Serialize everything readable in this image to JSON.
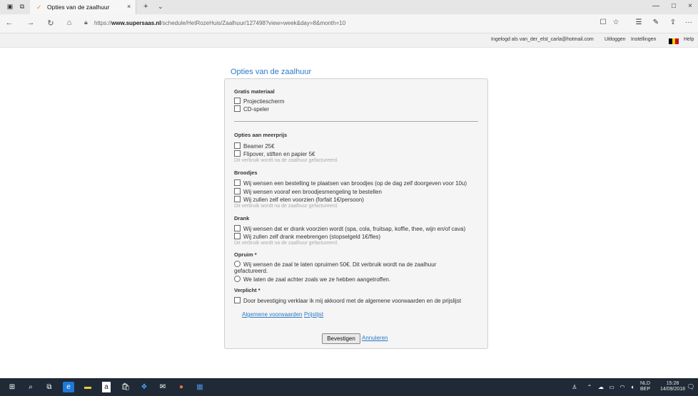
{
  "browser": {
    "tab_title": "Opties van de zaalhuur",
    "url_prefix": "https://",
    "url_domain": "www.supersaas.nl",
    "url_path": "/schedule/HetRozeHuis/Zaalhuur/127498?view=week&day=8&month=10",
    "icons": {
      "back": "←",
      "forward": "→",
      "refresh": "↻",
      "home": "⌂",
      "reading_view": "☐",
      "favorite": "☆",
      "hub": "☰",
      "notes": "✎",
      "share": "⇪",
      "more": "···",
      "new_tab": "+",
      "tab_close": "×",
      "tab_dropdown": "⌄",
      "minimize": "—",
      "maximize": "□",
      "close": "×"
    }
  },
  "userbar": {
    "logged_in_text": "Ingelogd als van_der_elst_carla@hotmail.com",
    "logout": "Uitloggen",
    "settings": "Instellingen",
    "help": "Help",
    "flag_colors": [
      "#000000",
      "#f5d300",
      "#d0021b"
    ]
  },
  "form": {
    "title": "Opties van de zaalhuur",
    "sections": {
      "gratis": {
        "heading": "Gratis materiaal",
        "options": [
          "Projectiescherm",
          "CD-speler"
        ]
      },
      "meerprijs": {
        "heading": "Opties aan meerprijs",
        "options": [
          "Beamer 25€",
          "Flipover, stiften en papier 5€"
        ],
        "note": "Dit verbruik wordt na de zaalhuur gefactureerd."
      },
      "broodjes": {
        "heading": "Broodjes",
        "options": [
          "Wij wensen een bestelling te plaatsen van broodjes (op de dag zelf doorgeven voor 10u)",
          "Wij wensen vooraf een broodjesmengeling te bestellen",
          "Wij zullen zelf eten voorzien (forfait 1€/persoon)"
        ],
        "note": "Dit verbruik wordt na de zaalhuur gefactureerd."
      },
      "drank": {
        "heading": "Drank",
        "options": [
          "Wij wensen dat er drank voorzien wordt (spa, cola, fruitsap, koffie, thee, wijn en/of cava)",
          "Wij zullen zelf drank meebrengen (stopselgeld 1€/fles)"
        ],
        "note": "Dit verbruik wordt na de zaalhuur gefactureerd."
      },
      "opruim": {
        "heading": "Opruim *",
        "options": [
          "Wij wensen de zaal te laten opruimen 50€. Dit verbruik wordt na de zaalhuur",
          "gefactureerd.",
          "We laten de zaal achter zoals we ze hebben aangetroffen."
        ]
      },
      "verplicht": {
        "heading": "Verplicht *",
        "options": [
          "Door bevestiging verklaar ik mij akkoord met de algemene voorwaarden en de prijslijst"
        ]
      }
    },
    "links": [
      "Algemene voorwaarden",
      "Prijslijst"
    ],
    "confirm": "Bevestigen",
    "cancel": "Annuleren"
  },
  "taskbar": {
    "icons": [
      "windows-start",
      "search",
      "task-view",
      "edge",
      "file-explorer",
      "amazon",
      "store",
      "dropbox",
      "mail",
      "firefox",
      "word"
    ],
    "lang_top": "NLD",
    "lang_bottom": "BEP",
    "time": "15:28",
    "date": "14/09/2018",
    "colors": {
      "taskbar": "#1f2a36",
      "edge": "#1e7ad6",
      "firefox": "#ff7139"
    }
  }
}
